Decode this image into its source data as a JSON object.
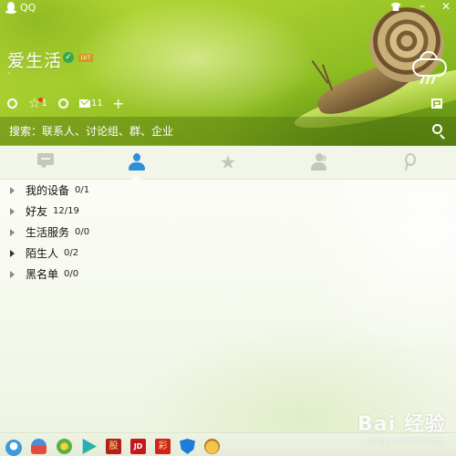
{
  "window": {
    "app_title": "QQ",
    "controls": {
      "skin": "shirt-icon",
      "minimize": "–",
      "close": "✕"
    }
  },
  "profile": {
    "name": "爱生活",
    "verified_badge": "✓",
    "level_badge": "LV7",
    "signature": "-",
    "weather_icon": "cloud-rain-icon"
  },
  "toolbar": {
    "items": [
      {
        "icon": "space-icon",
        "count": ""
      },
      {
        "icon": "star-icon",
        "count": "1"
      },
      {
        "icon": "refresh-icon",
        "count": ""
      },
      {
        "icon": "mail-icon",
        "count": "11"
      },
      {
        "icon": "plus-icon",
        "label": "+"
      }
    ],
    "app_manager_icon": "app-manager-icon"
  },
  "search": {
    "placeholder": "搜索：联系人、讨论组、群、企业"
  },
  "tabs": [
    {
      "name": "messages",
      "icon": "message-icon",
      "active": false
    },
    {
      "name": "contacts",
      "icon": "contacts-icon",
      "active": true
    },
    {
      "name": "favorites",
      "icon": "star-icon",
      "active": false
    },
    {
      "name": "groups",
      "icon": "group-icon",
      "active": false
    },
    {
      "name": "qzone",
      "icon": "qzone-icon",
      "active": false
    }
  ],
  "groups": [
    {
      "name": "我的设备",
      "count": "0/1"
    },
    {
      "name": "好友",
      "count": "12/19"
    },
    {
      "name": "生活服务",
      "count": "0/0"
    },
    {
      "name": "陌生人",
      "count": "0/2"
    },
    {
      "name": "黑名单",
      "count": "0/0"
    }
  ],
  "bottom_apps": [
    {
      "name": "qq-icon",
      "label": ""
    },
    {
      "name": "figure-icon",
      "label": ""
    },
    {
      "name": "music-icon",
      "label": ""
    },
    {
      "name": "video-play-icon",
      "label": ""
    },
    {
      "name": "stock-icon",
      "label": "股"
    },
    {
      "name": "jd-icon",
      "label": "JD"
    },
    {
      "name": "lottery-icon",
      "label": "彩"
    },
    {
      "name": "security-shield-icon",
      "label": ""
    },
    {
      "name": "pet-icon",
      "label": ""
    }
  ],
  "watermark": {
    "text": "Bai 经验",
    "sub": "jingyan.baidu.com"
  },
  "colors": {
    "header_green": "#a5cd2d",
    "active_tab_blue": "#2f8fd8",
    "list_bg": "#fbfcf6"
  }
}
